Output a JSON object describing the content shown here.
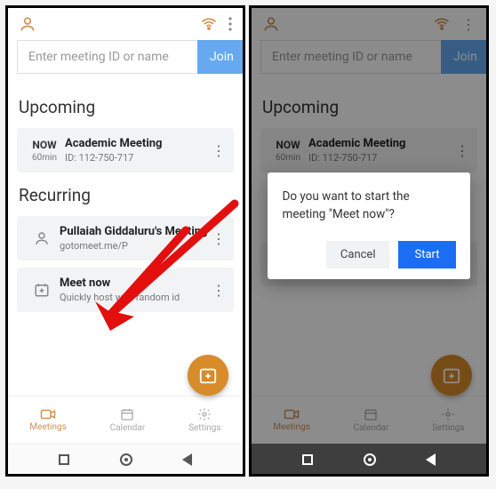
{
  "search": {
    "placeholder": "Enter meeting ID or name",
    "join_label": "Join"
  },
  "sections": {
    "upcoming": "Upcoming",
    "recurring": "Recurring"
  },
  "upcoming_item": {
    "time_label": "NOW",
    "duration": "60min",
    "title": "Academic Meeting",
    "id_line": "ID: 112-750-717"
  },
  "recurring_items": [
    {
      "title": "Pullaiah Giddaluru's Meeting",
      "sub": "gotomeet.me/P"
    },
    {
      "title": "Meet now",
      "sub": "Quickly host with random id"
    }
  ],
  "nav": {
    "meetings": "Meetings",
    "calendar": "Calendar",
    "settings": "Settings"
  },
  "dialog": {
    "message": "Do you want to start the meeting \"Meet now\"?",
    "cancel": "Cancel",
    "start": "Start"
  },
  "colors": {
    "accent": "#cf9152",
    "join": "#66a9f1",
    "fab": "#d78b29",
    "primary_blue": "#1b6ef3"
  }
}
